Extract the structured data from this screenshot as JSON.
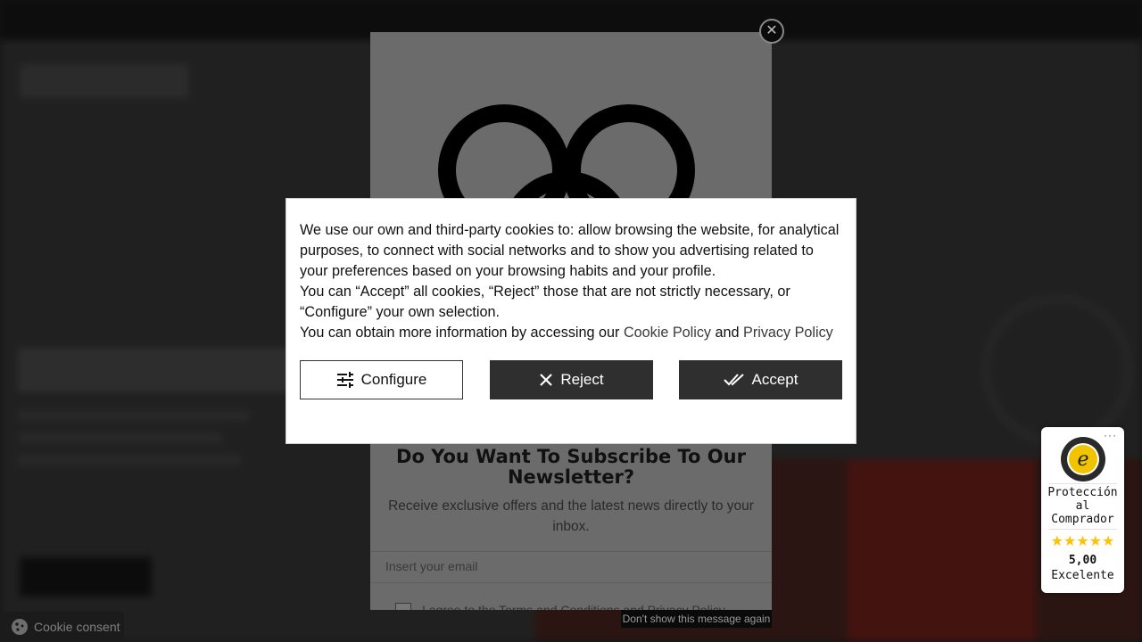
{
  "cookie_banner": {
    "paragraph_1": "We use our own and third-party cookies to: allow browsing the website, for analytical purposes, to connect with social networks and to show you advertising related to your preferences based on your browsing habits and your profile.",
    "paragraph_2": "You can “Accept” all cookies, “Reject” those that are not strictly necessary, or “Configure” your own selection.",
    "paragraph_3_prefix": "You can obtain more information by accessing our",
    "cookie_policy_link": "Cookie Policy",
    "and_text": "and",
    "privacy_policy_link": "Privacy Policy",
    "configure_label": "Configure",
    "reject_label": "Reject",
    "accept_label": "Accept",
    "icons": {
      "configure": "sliders-icon",
      "reject": "x-icon",
      "accept": "double-check-icon"
    }
  },
  "newsletter_popup": {
    "title": "Do You Want To Subscribe To Our Newsletter?",
    "description": "Receive exclusive offers and the latest news directly to your inbox.",
    "email_placeholder": "Insert your email",
    "terms_text": "I agree to the Terms and Conditions and Privacy Policy",
    "dont_show_again": "Don't show this message again",
    "close_icon": "close-icon"
  },
  "cookie_consent_tab": {
    "label": "Cookie consent",
    "icon": "cookie-icon"
  },
  "trusted_shops_badge": {
    "menu": "···",
    "label": "Protección al Comprador",
    "stars": "★★★★★",
    "score": "5,00",
    "rating_text": "Excelente",
    "star_color": "#ffc107"
  },
  "colors": {
    "button_dark": "#2f2f2f",
    "overlay": "#6b6b6b"
  }
}
